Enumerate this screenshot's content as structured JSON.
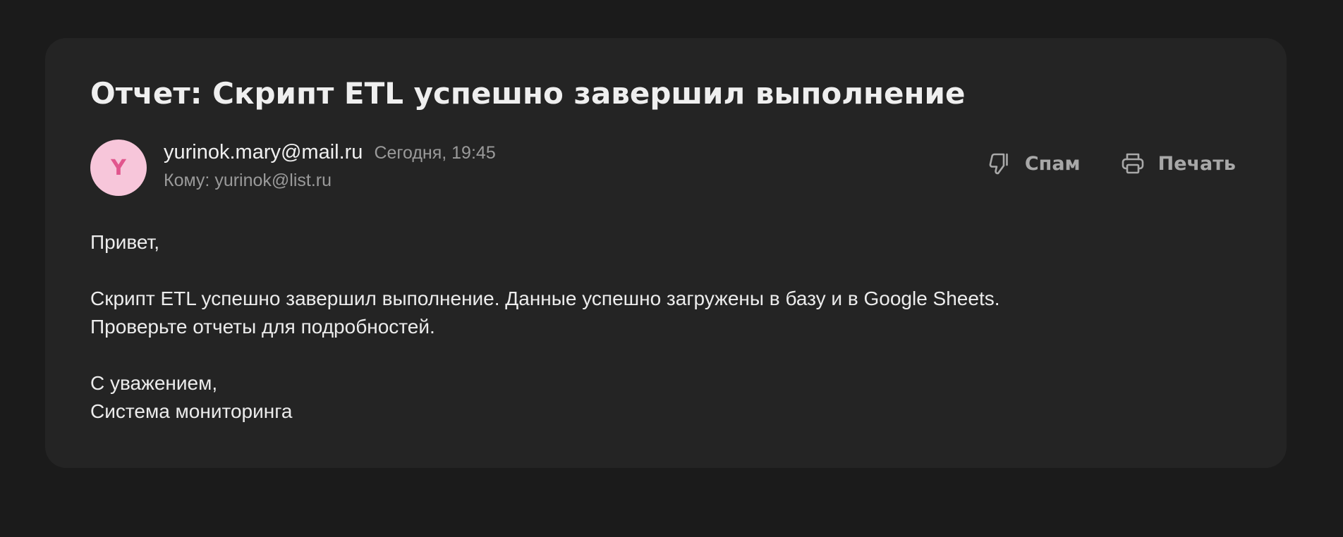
{
  "email": {
    "subject": "Отчет: Скрипт ETL успешно завершил выполнение",
    "sender": {
      "avatar_initial": "Y",
      "avatar_bg": "#f7c6da",
      "avatar_fg": "#e1568d",
      "email": "yurinok.mary@mail.ru",
      "date": "Сегодня, 19:45"
    },
    "recipient_line": "Кому: yurinok@list.ru",
    "actions": {
      "spam": {
        "label": "Спам",
        "icon": "thumbs-down-icon"
      },
      "print": {
        "label": "Печать",
        "icon": "printer-icon"
      }
    },
    "body": {
      "greeting": "Привет,",
      "line1": "Скрипт ETL успешно завершил выполнение. Данные успешно загружены в базу и в Google Sheets.",
      "line2": "Проверьте отчеты для подробностей.",
      "closing": "С уважением,",
      "signature": "Система мониторинга"
    }
  },
  "colors": {
    "page_bg": "#1b1b1b",
    "card_bg": "#242424",
    "text_primary": "#ececec",
    "text_secondary": "#9a9a9a"
  }
}
